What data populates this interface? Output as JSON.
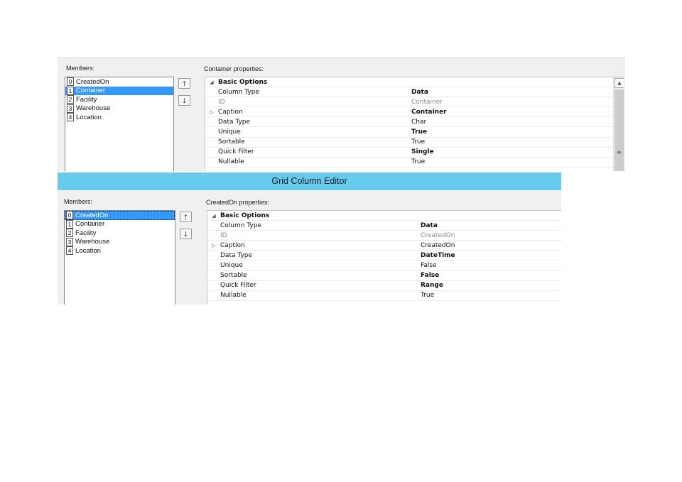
{
  "top_panel": {
    "members_label": "Members:",
    "members": [
      {
        "index": "0",
        "name": "CreatedOn"
      },
      {
        "index": "1",
        "name": "Container"
      },
      {
        "index": "2",
        "name": "Facility"
      },
      {
        "index": "3",
        "name": "Warehouse"
      },
      {
        "index": "4",
        "name": "Location"
      }
    ],
    "properties_label": "Container properties:",
    "rows": [
      {
        "name": "Basic Options",
        "value": ""
      },
      {
        "name": "Column Type",
        "value": "Data"
      },
      {
        "name": "ID",
        "value": "Container"
      },
      {
        "name": "Caption",
        "value": "Container"
      },
      {
        "name": "Data Type",
        "value": "Char"
      },
      {
        "name": "Unique",
        "value": "True"
      },
      {
        "name": "Sortable",
        "value": "True"
      },
      {
        "name": "Quick Filter",
        "value": "Single"
      },
      {
        "name": "Nullable",
        "value": "True"
      }
    ]
  },
  "window": {
    "title": "Grid Column Editor"
  },
  "bottom_panel": {
    "members_label": "Members:",
    "members": [
      {
        "index": "0",
        "name": "CreatedOn"
      },
      {
        "index": "1",
        "name": "Container"
      },
      {
        "index": "2",
        "name": "Facility"
      },
      {
        "index": "3",
        "name": "Warehouse"
      },
      {
        "index": "4",
        "name": "Location"
      }
    ],
    "properties_label": "CreatedOn properties:",
    "rows": [
      {
        "name": "Basic Options",
        "value": ""
      },
      {
        "name": "Column Type",
        "value": "Data"
      },
      {
        "name": "ID",
        "value": "CreatedOn"
      },
      {
        "name": "Caption",
        "value": "CreatedOn"
      },
      {
        "name": "Data Type",
        "value": "DateTime"
      },
      {
        "name": "Unique",
        "value": "False"
      },
      {
        "name": "Sortable",
        "value": "False"
      },
      {
        "name": "Quick Filter",
        "value": "Range"
      },
      {
        "name": "Nullable",
        "value": "True"
      }
    ]
  },
  "icons": {
    "move_up": "arrow-up-icon",
    "move_down": "arrow-down-icon",
    "collapse": "triangle-collapse-icon",
    "expand": "triangle-expand-icon"
  },
  "colors": {
    "title_bar": "#66ccee",
    "selection": "#3399ff"
  }
}
